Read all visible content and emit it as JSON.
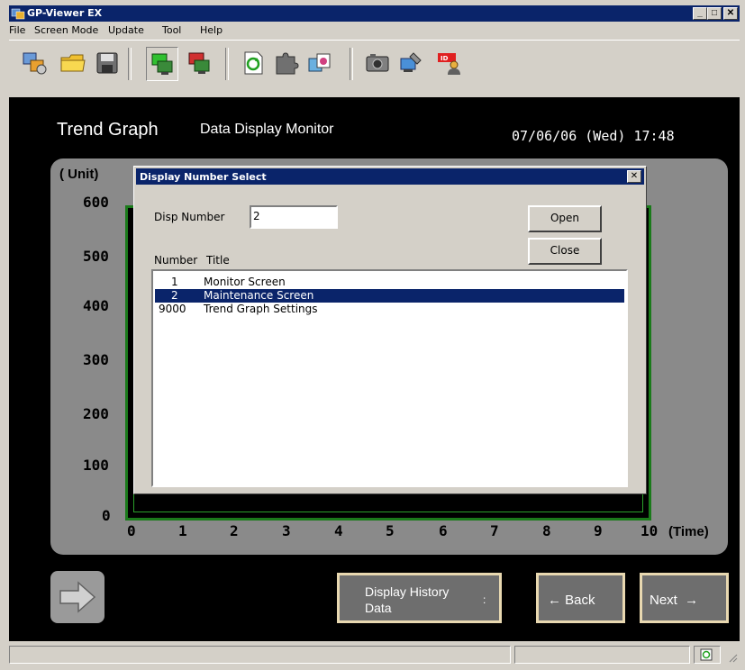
{
  "window": {
    "title": "GP-Viewer EX",
    "min_glyph": "_",
    "max_glyph": "□",
    "close_glyph": "✕"
  },
  "menu": [
    "File",
    "Screen Mode",
    "Update",
    "Tool",
    "Help"
  ],
  "screen": {
    "title": "Trend Graph",
    "subtitle": "Data Display Monitor",
    "datetime": "07/06/06 (Wed) 17:48",
    "y_unit": "( Unit)",
    "y_ticks": [
      "600",
      "500",
      "400",
      "300",
      "200",
      "100",
      "0"
    ],
    "x_ticks": [
      "0",
      "1",
      "2",
      "3",
      "4",
      "5",
      "6",
      "7",
      "8",
      "9",
      "10"
    ],
    "x_unit": "(Time)",
    "history_line1": "Display History",
    "history_line2": "Data",
    "history_dot": ":",
    "back_label": "← Back",
    "next_label": "Next  →"
  },
  "dialog": {
    "title": "Display Number Select",
    "close_glyph": "✕",
    "disp_number_label": "Disp Number",
    "disp_number_value": "2",
    "open_label": "Open",
    "close_label": "Close",
    "col_number": "Number",
    "col_title": "Title",
    "rows": [
      {
        "number": "1",
        "title": "Monitor Screen",
        "selected": false
      },
      {
        "number": "2",
        "title": "Maintenance Screen",
        "selected": true
      },
      {
        "number": "9000",
        "title": "Trend Graph Settings",
        "selected": false
      }
    ]
  },
  "colors": {
    "titlebar": "#0a246a",
    "chrome": "#d4d0c8",
    "plot_border": "#1a7a1a",
    "panel": "#8a8a8a"
  }
}
